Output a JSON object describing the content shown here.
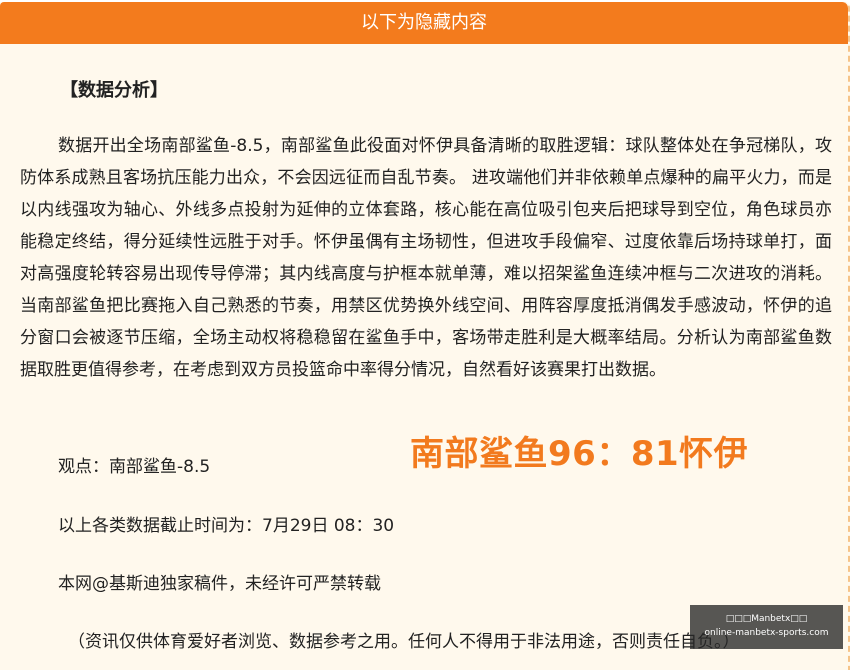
{
  "header": {
    "title": "以下为隐藏内容"
  },
  "article": {
    "section_title": "【数据分析】",
    "analysis": "数据开出全场南部鲨鱼-8.5，南部鲨鱼此役面对怀伊具备清晰的取胜逻辑：球队整体处在争冠梯队，攻防体系成熟且客场抗压能力出众，不会因远征而自乱节奏。 进攻端他们并非依赖单点爆种的扁平火力，而是以内线强攻为轴心、外线多点投射为延伸的立体套路，核心能在高位吸引包夹后把球导到空位，角色球员亦能稳定终结，得分延续性远胜于对手。怀伊虽偶有主场韧性，但进攻手段偏窄、过度依靠后场持球单打，面对高强度轮转容易出现传导停滞；其内线高度与护框本就单薄，难以招架鲨鱼连续冲框与二次进攻的消耗。 当南部鲨鱼把比赛拖入自己熟悉的节奏，用禁区优势换外线空间、用阵容厚度抵消偶发手感波动，怀伊的追分窗口会被逐节压缩，全场主动权将稳稳留在鲨鱼手中，客场带走胜利是大概率结局。分析认为南部鲨鱼数据取胜更值得参考，在考虑到双方员投篮命中率得分情况，自然看好该赛果打出数据。",
    "score_highlight": "南部鲨鱼96：81怀伊",
    "viewpoint": "观点：南部鲨鱼-8.5",
    "cutoff_time": "以上各类数据截止时间为：7月29日 08：30",
    "copyright": "本网@基斯迪独家稿件，未经许可严禁转载",
    "disclaimer": "（资讯仅供体育爱好者浏览、数据参考之用。任何人不得用于非法用途，否则责任自负。）"
  },
  "watermark": {
    "line1": "□□□Manbetx□□",
    "line2": "online-manbetx-sports.com"
  },
  "colors": {
    "header_bg": "#f37b1d",
    "panel_bg": "#fff9ed",
    "highlight": "#f27a1e",
    "border_dashed": "#f6c489"
  }
}
